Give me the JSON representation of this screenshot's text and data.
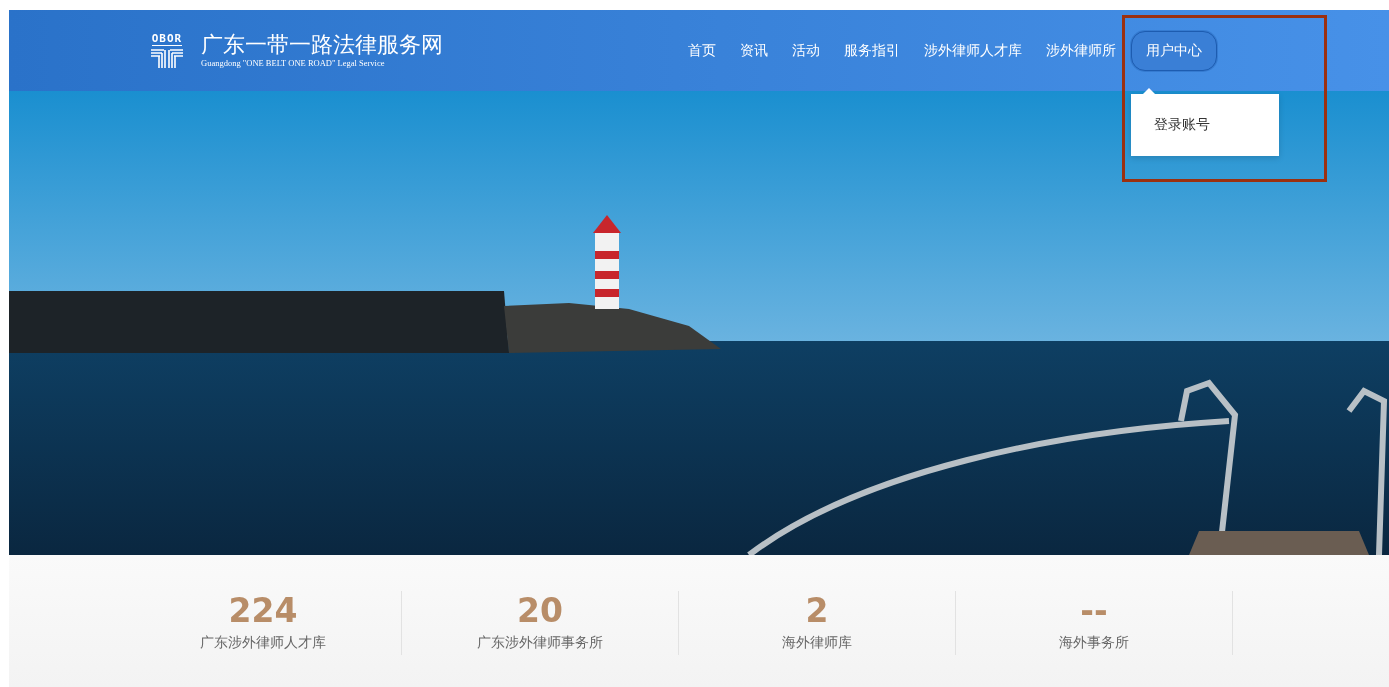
{
  "header": {
    "logo": {
      "mark": "OBOR",
      "title": "广东一带一路法律服务网",
      "subtitle": "Guangdong \"ONE BELT ONE ROAD\" Legal Service"
    },
    "nav": [
      {
        "label": "首页",
        "selected": false
      },
      {
        "label": "资讯",
        "selected": false
      },
      {
        "label": "活动",
        "selected": false
      },
      {
        "label": "服务指引",
        "selected": false
      },
      {
        "label": "涉外律师人才库",
        "selected": false
      },
      {
        "label": "涉外律师所",
        "selected": false
      },
      {
        "label": "用户中心",
        "selected": true,
        "expanded": true,
        "menu": [
          "登录账号"
        ]
      }
    ]
  },
  "stats": [
    {
      "value": "224",
      "label": "广东涉外律师人才库"
    },
    {
      "value": "20",
      "label": "广东涉外律师事务所"
    },
    {
      "value": "2",
      "label": "海外律师库"
    },
    {
      "value": "--",
      "label": "海外事务所"
    }
  ]
}
